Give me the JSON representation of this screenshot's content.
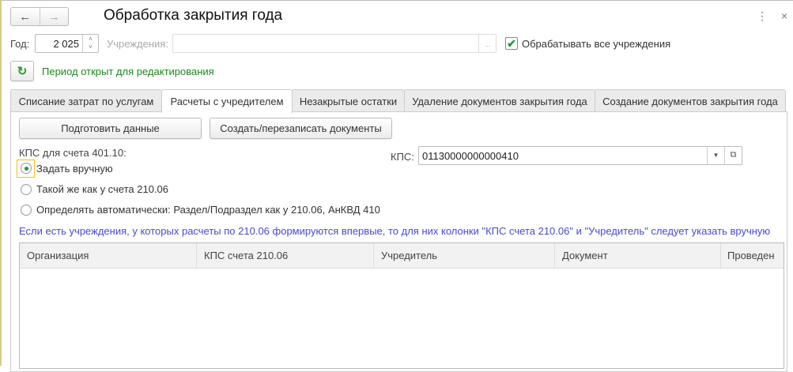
{
  "header": {
    "title": "Обработка закрытия года",
    "back": "←",
    "forward": "→",
    "more": "⋮",
    "close": "×"
  },
  "filters": {
    "year_label": "Год:",
    "year_value": "2 025",
    "institutions_label": "Учреждения:",
    "institutions_value": "",
    "select_btn": "...",
    "process_all_label": "Обрабатывать все учреждения",
    "process_all_checked": true
  },
  "status": {
    "refresh_icon": "refresh-icon",
    "text": "Период открыт для редактирования",
    "color": "#1a8a1a"
  },
  "tabs": [
    "Списание затрат по услугам",
    "Расчеты с учредителем",
    "Незакрытые остатки",
    "Удаление документов закрытия года",
    "Создание документов закрытия года"
  ],
  "active_tab": 1,
  "panel": {
    "prepare_button": "Подготовить данные",
    "create_button": "Создать/перезаписать документы",
    "kps_group_label": "КПС для счета 401.10:",
    "radios": [
      "Задать вручную",
      "Такой же как у счета 210.06",
      "Определять автоматически: Раздел/Подраздел как у 210.06, АнКВД 410"
    ],
    "selected_radio": 0,
    "kps_label": "КПС:",
    "kps_value": "01130000000000410",
    "hint": "Если есть учреждения, у которых расчеты по 210.06 формируются впервые, то для них колонки \"КПС счета 210.06\" и \"Учредитель\" следует указать вручную",
    "hint_color": "#4a4acc",
    "table": {
      "columns": [
        "Организация",
        "КПС счета 210.06",
        "Учредитель",
        "Документ",
        "Проведен"
      ],
      "rows": []
    }
  }
}
